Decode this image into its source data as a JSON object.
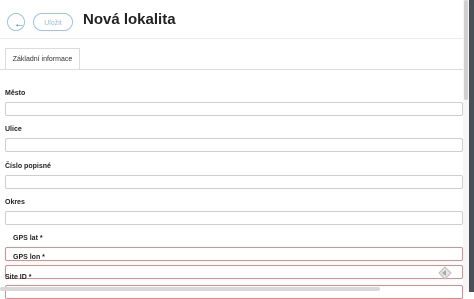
{
  "header": {
    "back_icon": "arrow-left-icon",
    "back_glyph": "←",
    "save_label": "Uložit",
    "title": "Nová lokalita"
  },
  "tabs": [
    {
      "label": "Základní informace",
      "active": true
    }
  ],
  "form": {
    "fields": [
      {
        "label": "Město",
        "value": ""
      },
      {
        "label": "Ulice",
        "value": ""
      },
      {
        "label": "Číslo popisné",
        "value": ""
      },
      {
        "label": "Okres",
        "value": ""
      },
      {
        "label": "GPS lat *",
        "value": "",
        "error": true
      },
      {
        "label": "GPS lon *",
        "value": "",
        "error": true
      },
      {
        "label": "Site ID *",
        "value": "",
        "error": true
      }
    ]
  },
  "colors": {
    "accent": "#3a7bd5",
    "error": "#e58a8a"
  },
  "icons": {
    "floating": "diamond-nav-icon"
  }
}
